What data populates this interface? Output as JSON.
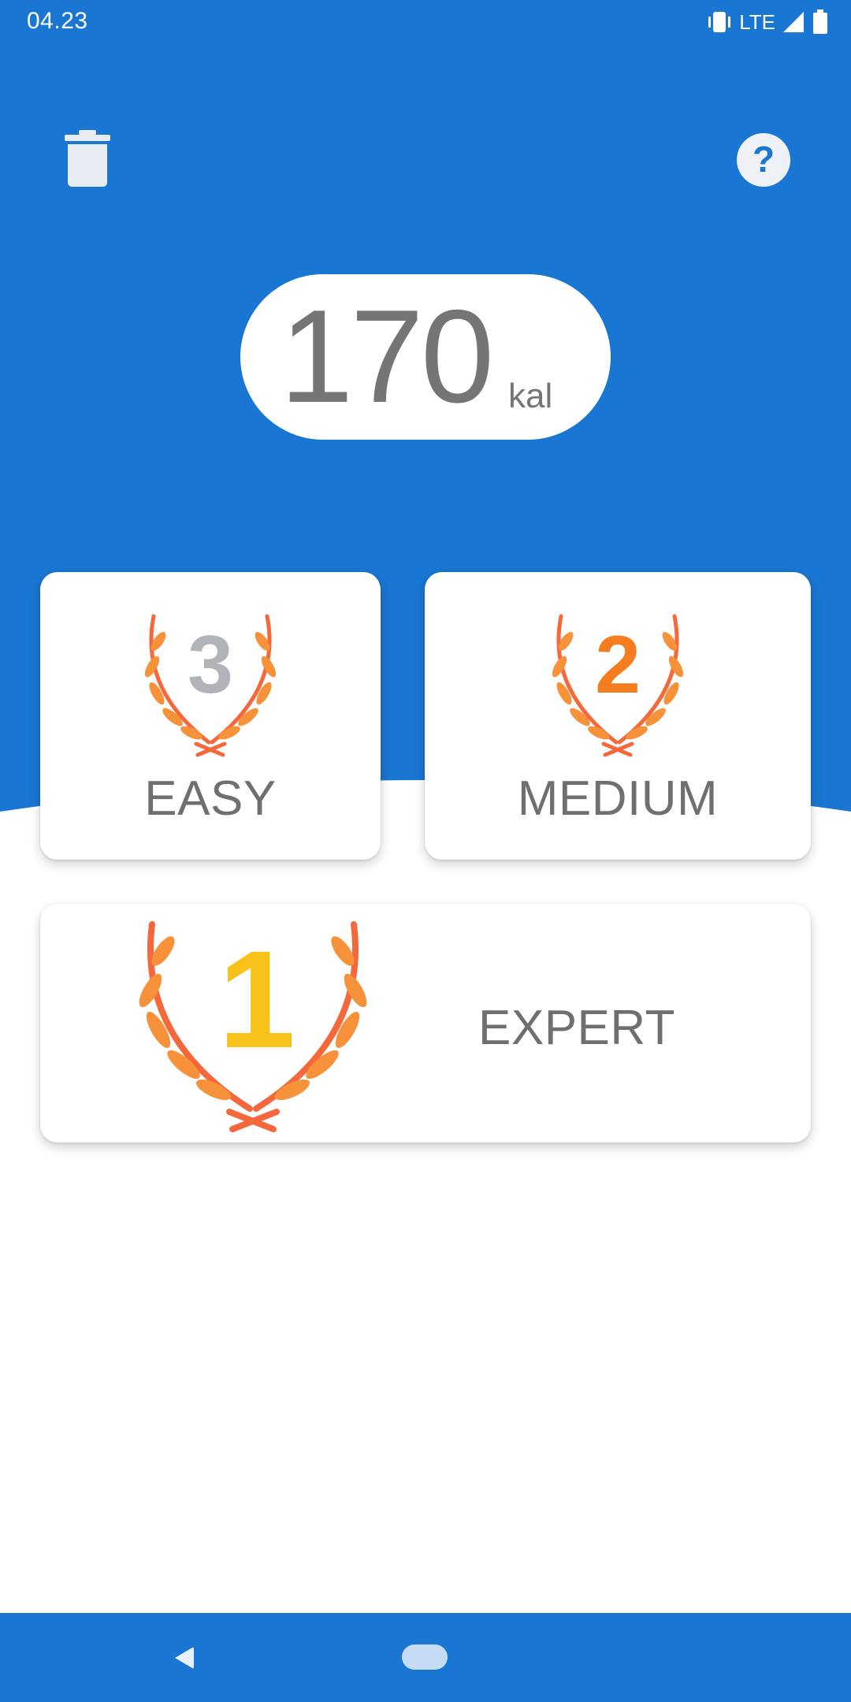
{
  "status_bar": {
    "time": "04.23",
    "network": "LTE",
    "icons": [
      "vibrate-icon",
      "signal-icon",
      "battery-icon"
    ]
  },
  "toolbar": {
    "delete_icon": "trash-icon",
    "help_icon": "help-icon"
  },
  "calories": {
    "value": "170",
    "unit": "kal"
  },
  "levels": [
    {
      "rank": "3",
      "label": "EASY",
      "rank_color": "#b0b3b8"
    },
    {
      "rank": "2",
      "label": "MEDIUM",
      "rank_color": "#f57c1f"
    },
    {
      "rank": "1",
      "label": "EXPERT",
      "rank_color": "#f9c21a"
    }
  ],
  "colors": {
    "primary": "#1976d2",
    "laurel": "#f47a3a",
    "text": "#6f6f6f"
  },
  "nav_bar": {
    "back_icon": "back-icon",
    "home_icon": "home-pill-icon"
  }
}
